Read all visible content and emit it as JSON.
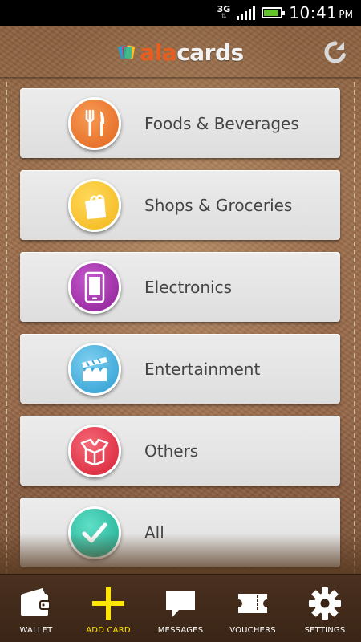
{
  "status_bar": {
    "network": "3G",
    "network_arrows": "⇅",
    "time": "10:41",
    "ampm": "PM",
    "battery_level": 0.9
  },
  "app": {
    "logo_part1": "ala",
    "logo_part2": "cards"
  },
  "categories": [
    {
      "label": "Foods & Beverages",
      "icon": "fork-knife-icon",
      "color": "#e9722a"
    },
    {
      "label": "Shops & Groceries",
      "icon": "shopping-bag-icon",
      "color": "#f6c22c"
    },
    {
      "label": "Electronics",
      "icon": "smartphone-icon",
      "color": "#a02aa8"
    },
    {
      "label": "Entertainment",
      "icon": "clapperboard-icon",
      "color": "#3aa9da"
    },
    {
      "label": "Others",
      "icon": "open-box-icon",
      "color": "#e02b40"
    },
    {
      "label": "All",
      "icon": "checkmark-icon",
      "color": "#25b89c"
    }
  ],
  "bottom_nav": [
    {
      "label": "WALLET",
      "icon": "wallet-icon"
    },
    {
      "label": "ADD CARD",
      "icon": "plus-icon",
      "active": true,
      "color": "#ffe600"
    },
    {
      "label": "MESSAGES",
      "icon": "speech-bubble-icon"
    },
    {
      "label": "VOUCHERS",
      "icon": "ticket-icon"
    },
    {
      "label": "SETTINGS",
      "icon": "gear-icon"
    }
  ]
}
